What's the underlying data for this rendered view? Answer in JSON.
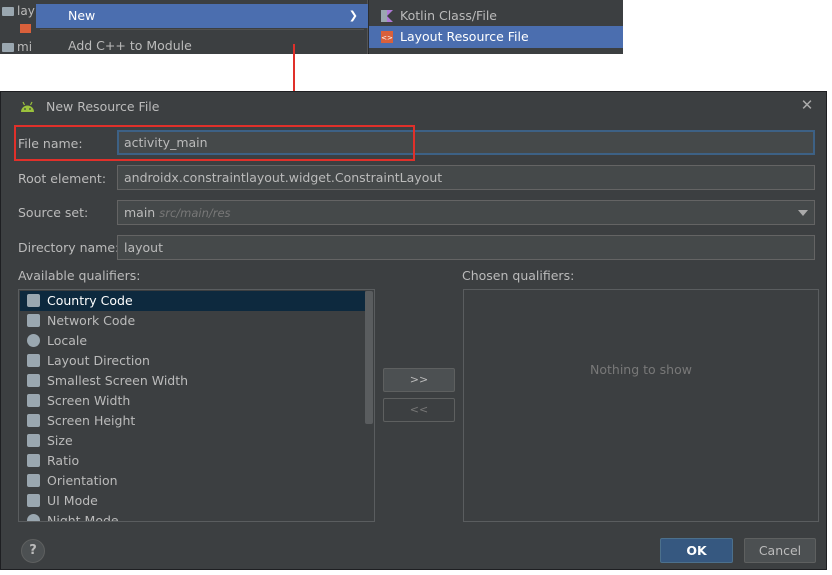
{
  "context_menu": {
    "tree": {
      "row1": "lay",
      "row2": "mi"
    },
    "items": [
      {
        "label": "New",
        "selected": true
      },
      {
        "label": "Add C++ to Module",
        "selected": false
      }
    ],
    "submenu": [
      {
        "label": "Kotlin Class/File",
        "icon": "kotlin-icon",
        "selected": false
      },
      {
        "label": "Layout Resource File",
        "icon": "layout-file-icon",
        "selected": true
      }
    ]
  },
  "dialog": {
    "title": "New Resource File",
    "fields": {
      "file_name": {
        "label": "File name:",
        "value": "activity_main"
      },
      "root_element": {
        "label": "Root element:",
        "value": "androidx.constraintlayout.widget.ConstraintLayout"
      },
      "source_set": {
        "label": "Source set:",
        "value": "main",
        "hint": "src/main/res"
      },
      "directory_name": {
        "label": "Directory name:",
        "value": "layout"
      }
    },
    "available_label": "Available qualifiers:",
    "chosen_label": "Chosen qualifiers:",
    "qualifiers": [
      {
        "label": "Country Code",
        "icon": "country-code-icon"
      },
      {
        "label": "Network Code",
        "icon": "network-code-icon"
      },
      {
        "label": "Locale",
        "icon": "globe-icon"
      },
      {
        "label": "Layout Direction",
        "icon": "layout-direction-icon"
      },
      {
        "label": "Smallest Screen Width",
        "icon": "smallest-width-icon"
      },
      {
        "label": "Screen Width",
        "icon": "screen-width-icon"
      },
      {
        "label": "Screen Height",
        "icon": "screen-height-icon"
      },
      {
        "label": "Size",
        "icon": "size-icon"
      },
      {
        "label": "Ratio",
        "icon": "ratio-icon"
      },
      {
        "label": "Orientation",
        "icon": "orientation-icon"
      },
      {
        "label": "UI Mode",
        "icon": "ui-mode-icon"
      },
      {
        "label": "Night Mode",
        "icon": "night-mode-icon"
      }
    ],
    "add_button": ">>",
    "remove_button": "<<",
    "empty_text": "Nothing to show",
    "help": "?",
    "ok": "OK",
    "cancel": "Cancel"
  },
  "colors": {
    "dialog_bg": "#3c3f41",
    "selection": "#4b6eaf",
    "list_selection": "#0d293e",
    "annotation": "#e0302a",
    "primary_button": "#365880"
  }
}
